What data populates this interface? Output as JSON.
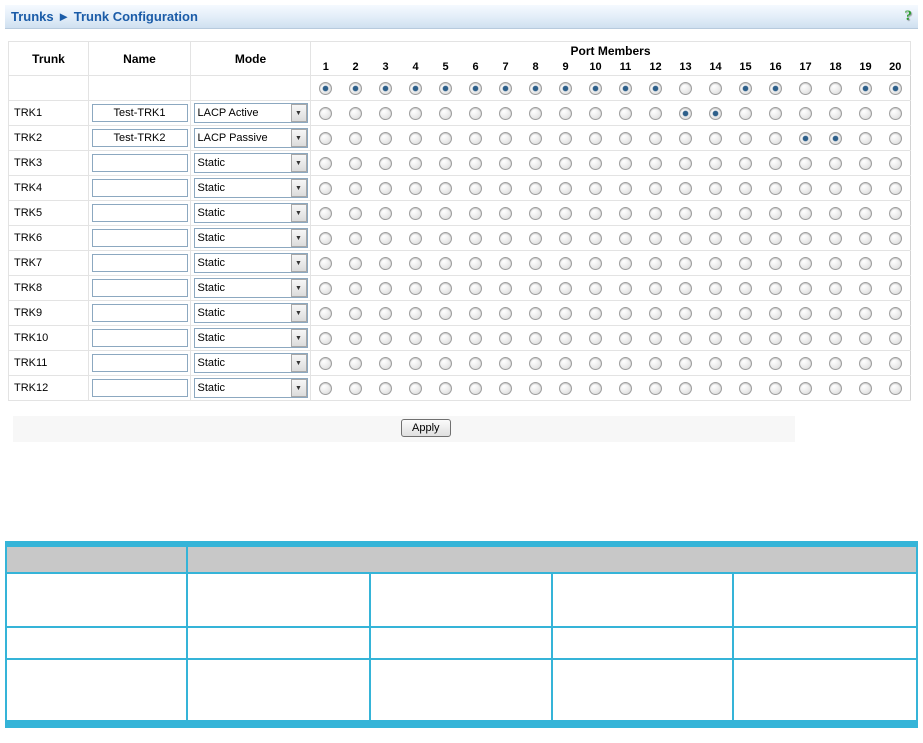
{
  "header": {
    "breadcrumb": "Trunks ► Trunk Configuration",
    "help_icon_label": "?"
  },
  "trunk_table": {
    "headers": {
      "trunk": "Trunk",
      "name": "Name",
      "mode": "Mode",
      "port_members": "Port Members"
    },
    "ports": [
      "1",
      "2",
      "3",
      "4",
      "5",
      "6",
      "7",
      "8",
      "9",
      "10",
      "11",
      "12",
      "13",
      "14",
      "15",
      "16",
      "17",
      "18",
      "19",
      "20"
    ],
    "default_row": {
      "trunk": "",
      "name": "",
      "mode": "",
      "selected_ports": [
        1,
        2,
        3,
        4,
        5,
        6,
        7,
        8,
        9,
        10,
        11,
        12,
        15,
        16,
        19,
        20
      ]
    },
    "rows": [
      {
        "trunk": "TRK1",
        "name": "Test-TRK1",
        "mode": "LACP Active",
        "selected_ports": [
          13,
          14
        ]
      },
      {
        "trunk": "TRK2",
        "name": "Test-TRK2",
        "mode": "LACP Passive",
        "selected_ports": [
          17,
          18
        ]
      },
      {
        "trunk": "TRK3",
        "name": "",
        "mode": "Static",
        "selected_ports": []
      },
      {
        "trunk": "TRK4",
        "name": "",
        "mode": "Static",
        "selected_ports": []
      },
      {
        "trunk": "TRK5",
        "name": "",
        "mode": "Static",
        "selected_ports": []
      },
      {
        "trunk": "TRK6",
        "name": "",
        "mode": "Static",
        "selected_ports": []
      },
      {
        "trunk": "TRK7",
        "name": "",
        "mode": "Static",
        "selected_ports": []
      },
      {
        "trunk": "TRK8",
        "name": "",
        "mode": "Static",
        "selected_ports": []
      },
      {
        "trunk": "TRK9",
        "name": "",
        "mode": "Static",
        "selected_ports": []
      },
      {
        "trunk": "TRK10",
        "name": "",
        "mode": "Static",
        "selected_ports": []
      },
      {
        "trunk": "TRK11",
        "name": "",
        "mode": "Static",
        "selected_ports": []
      },
      {
        "trunk": "TRK12",
        "name": "",
        "mode": "Static",
        "selected_ports": []
      }
    ],
    "apply_label": "Apply"
  },
  "description_table": {
    "header_cells": [
      "",
      ""
    ],
    "rows": [
      [
        "",
        "",
        "",
        "",
        ""
      ],
      [
        "",
        "",
        "",
        "",
        ""
      ],
      [
        "",
        "",
        "",
        "",
        ""
      ]
    ]
  },
  "colors": {
    "breadcrumb_text": "#1b5ca8",
    "help_icon_green": "#2f9e33",
    "table_border": "#e3e3e3",
    "radio_selected_dot": "#2d5f8a",
    "description_border_cyan": "#35b4d8",
    "description_header_gray": "#c8c8c8"
  }
}
